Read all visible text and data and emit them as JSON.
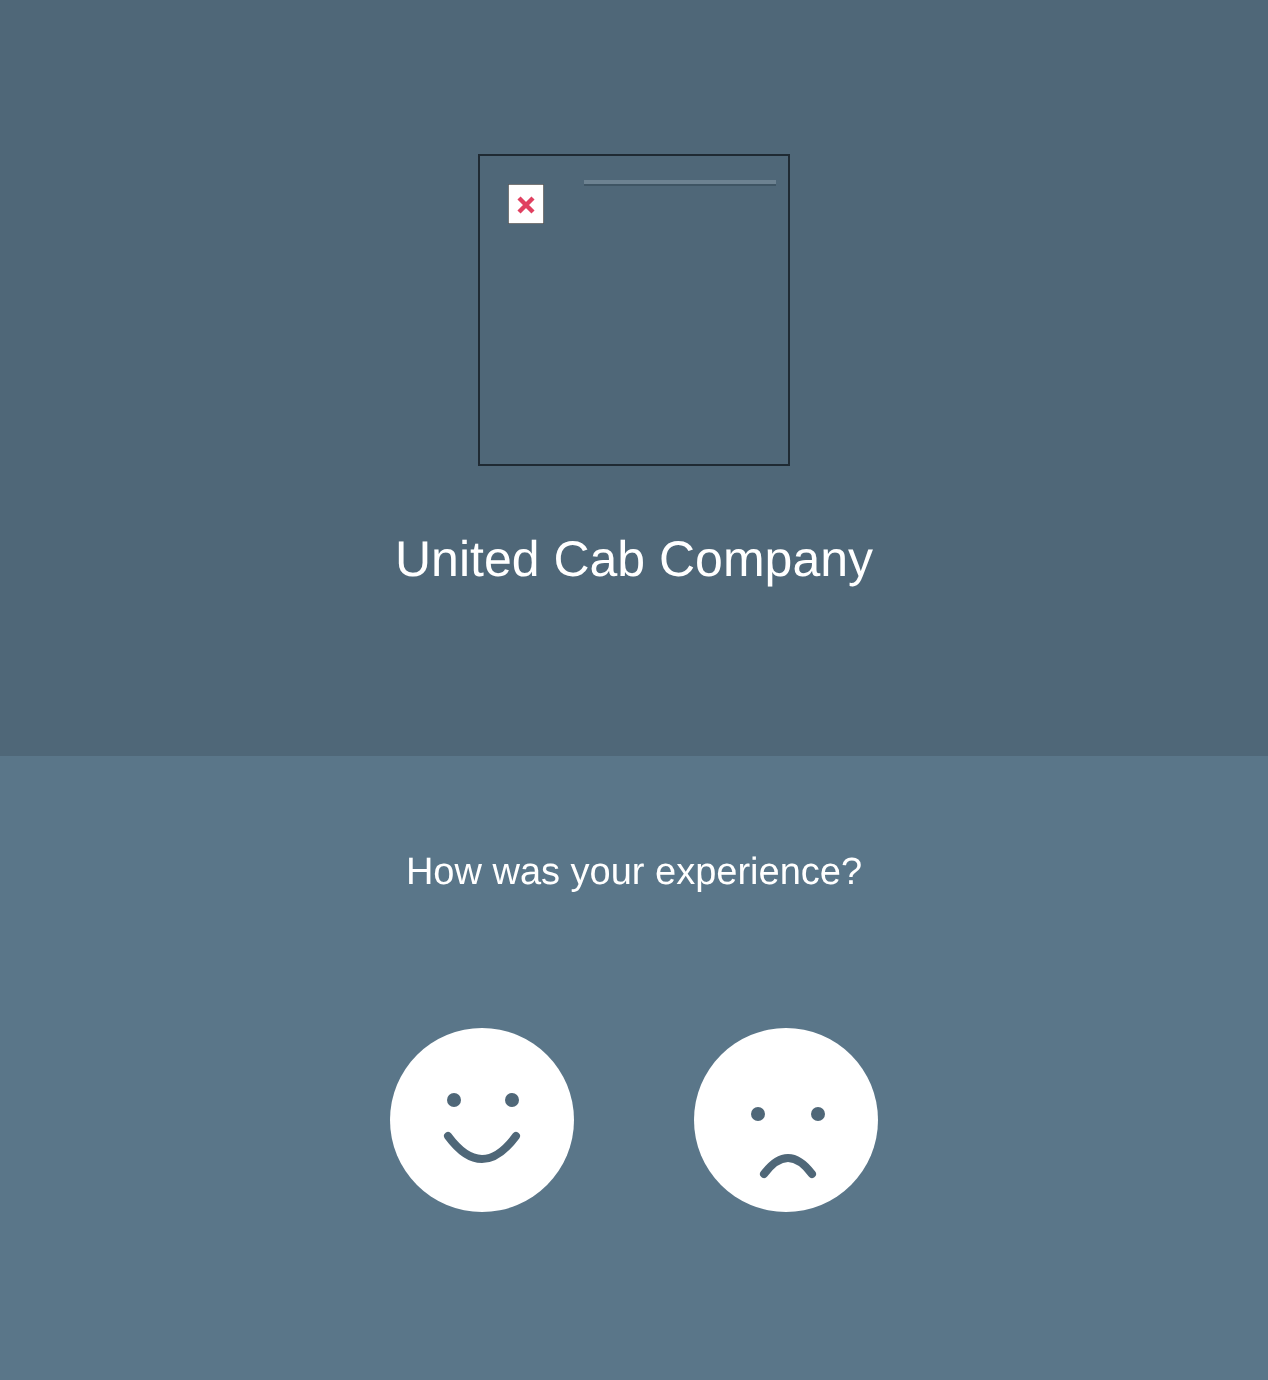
{
  "company": {
    "name": "United Cab Company"
  },
  "survey": {
    "question": "How was your experience?",
    "ratings": [
      {
        "kind": "happy"
      },
      {
        "kind": "sad"
      }
    ]
  }
}
